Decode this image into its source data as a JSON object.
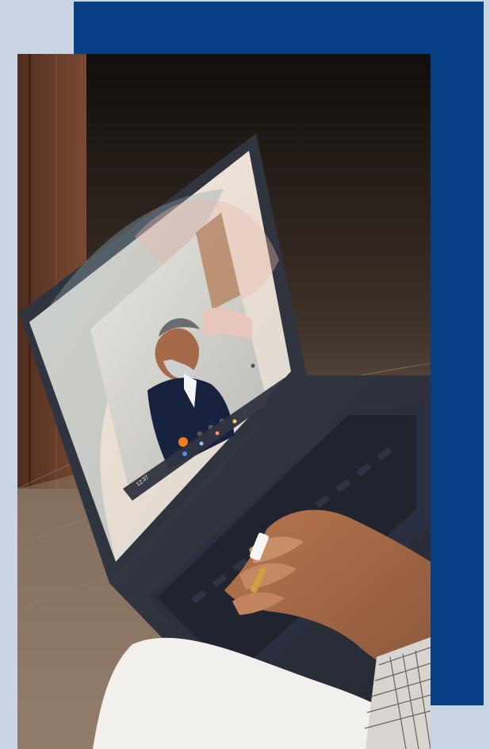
{
  "colors": {
    "page_background": "#c9d5e3",
    "accent_panel": "#063f86"
  },
  "screen": {
    "clock_text": "12:37"
  }
}
